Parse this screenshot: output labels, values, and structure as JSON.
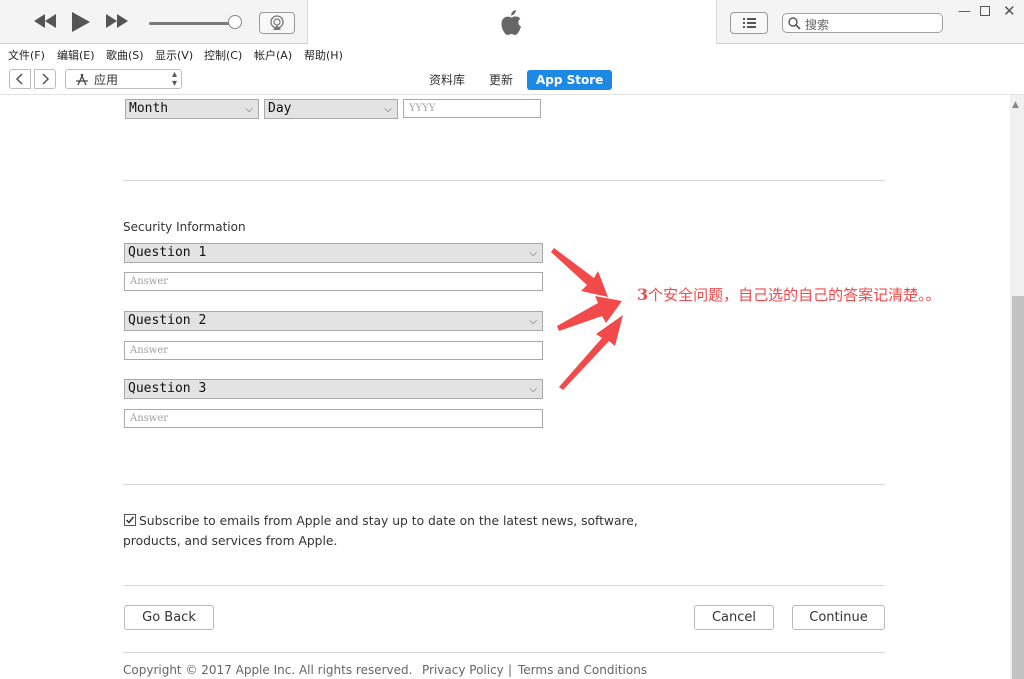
{
  "menu": [
    "文件(F)",
    "编辑(E)",
    "歌曲(S)",
    "显示(V)",
    "控制(C)",
    "帐户(A)",
    "帮助(H)"
  ],
  "search": {
    "placeholder": "搜索"
  },
  "app_selector": {
    "value": "应用"
  },
  "tabs": [
    {
      "label": "资料库"
    },
    {
      "label": "更新"
    },
    {
      "label": "App Store"
    }
  ],
  "birthday": {
    "month": "Month",
    "day": "Day",
    "year_placeholder": "YYYY"
  },
  "security": {
    "title": "Security Information",
    "questions": [
      {
        "label": "Question 1",
        "answer_placeholder": "Answer"
      },
      {
        "label": "Question 2",
        "answer_placeholder": "Answer"
      },
      {
        "label": "Question 3",
        "answer_placeholder": "Answer"
      }
    ]
  },
  "annotation": {
    "number": "3",
    "text": "个安全问题，自己选的自己的答案记清楚。。",
    "color": "#f2494b"
  },
  "subscribe": {
    "line1": "Subscribe to emails from Apple and stay up to date on the latest news, software,",
    "line2": "products, and services from Apple.",
    "checked": true
  },
  "buttons": {
    "go_back": "Go Back",
    "cancel": "Cancel",
    "continue": "Continue"
  },
  "footer": {
    "copyright": "Copyright © 2017 Apple Inc. All rights reserved.",
    "privacy": "Privacy Policy",
    "separator": "|",
    "terms": "Terms and Conditions"
  },
  "icons": [
    "rewind-icon",
    "play-icon",
    "fast-forward-icon",
    "airplay-icon",
    "apple-logo-icon",
    "list-icon",
    "search-icon",
    "minimize-icon",
    "maximize-icon",
    "close-icon",
    "back-icon",
    "forward-icon",
    "app-store-icon",
    "chevron-down-icon",
    "checkbox-checked-icon",
    "arrow-icon"
  ],
  "accent_color": "#1e88e5"
}
